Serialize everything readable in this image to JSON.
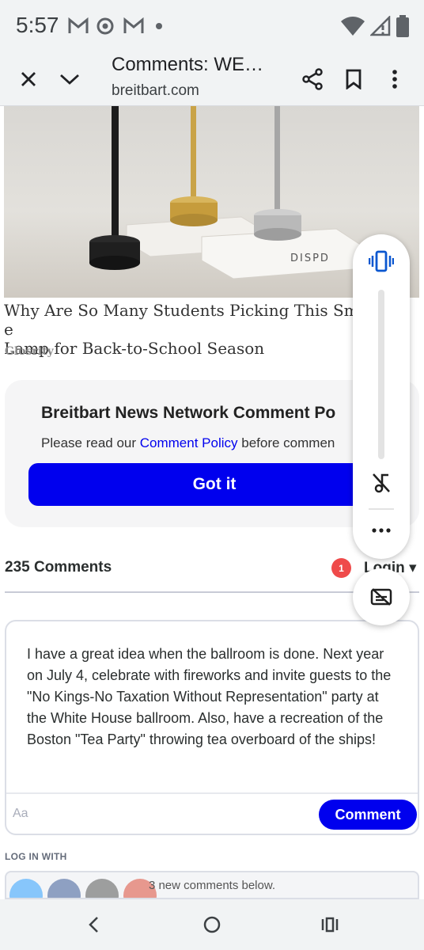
{
  "status_bar": {
    "time": "5:57",
    "icons": [
      "gmail-icon",
      "chrome-icon",
      "gmail-icon",
      "dot-icon",
      "wifi-icon",
      "signal-icon",
      "battery-icon"
    ]
  },
  "toolbar": {
    "title": "Comments: WE…",
    "url": "breitbart.com"
  },
  "ad": {
    "title": "Why Are So Many Students Picking This Sma… e Lamp for Back-to-School Season",
    "title_line1": "Why Are So Many Students Picking This Sma",
    "title_line1_tail": "e",
    "title_line2": "Lamp for Back-to-School Season",
    "source": "Glosrity",
    "product_label": "DISPD"
  },
  "policy": {
    "title": "Breitbart News Network Comment Po",
    "text_before": "Please read our ",
    "link": "Comment Policy",
    "text_after": " before commen",
    "button": "Got it"
  },
  "comments": {
    "count_label": "235 Comments",
    "notification_count": "1",
    "login_label": "Login ▾"
  },
  "editor": {
    "text": "I have a great idea when the ballroom is done.  Next year on July 4, celebrate with fireworks and invite guests to the \"No Kings-No Taxation Without Representation\" party at the White House ballroom. Also, have a recreation of the Boston \"Tea Party\" throwing tea overboard of the ships!",
    "placeholder": "Aa",
    "submit_label": "Comment"
  },
  "login_with": {
    "label": "LOG IN WITH",
    "new_comments": "3 new comments below."
  },
  "colors": {
    "accent": "#0000ee",
    "badge": "#ef4a4a",
    "chrome": "#f1f3f4"
  }
}
